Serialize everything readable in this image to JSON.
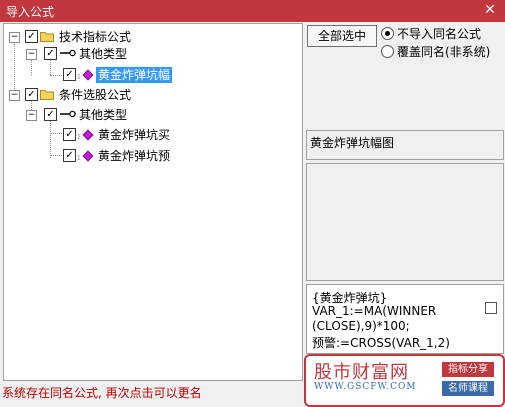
{
  "window": {
    "title": "导入公式",
    "close_glyph": "✕"
  },
  "tree": {
    "items": [
      {
        "label": "技术指标公式",
        "expander": "−"
      },
      {
        "label": "其他类型",
        "expander": "−"
      },
      {
        "label": "黄金炸弹坑幅"
      },
      {
        "label": "条件选股公式",
        "expander": "−"
      },
      {
        "label": "其他类型",
        "expander": "−"
      },
      {
        "label": "黄金炸弹坑买"
      },
      {
        "label": "黄金炸弹坑预"
      }
    ],
    "check_glyph": "✓"
  },
  "controls": {
    "select_all_label": "全部选中",
    "radio_options": [
      {
        "label": "不导入同名公式",
        "selected": true
      },
      {
        "label": "覆盖同名(非系统)",
        "selected": false
      }
    ]
  },
  "detail": {
    "formula_name": "黄金炸弹坑幅图",
    "code_lines": [
      "{黄金炸弹坑}",
      "VAR_1:=MA(WINNER",
      "(CLOSE),9)*100;",
      "预警:=CROSS(VAR_1,2)"
    ]
  },
  "status": "系统存在同名公式, 再次点击可以更名",
  "watermark": {
    "main": "股市财富网",
    "url": "WWW.GSCFW.COM",
    "tag1": "指标分享",
    "tag2": "名师课程"
  },
  "colors": {
    "title_bar": "#c0373e",
    "selection": "#3399ff",
    "status_text": "#c00000",
    "gem": "#c21bd6",
    "folder": "#f3d35a"
  }
}
